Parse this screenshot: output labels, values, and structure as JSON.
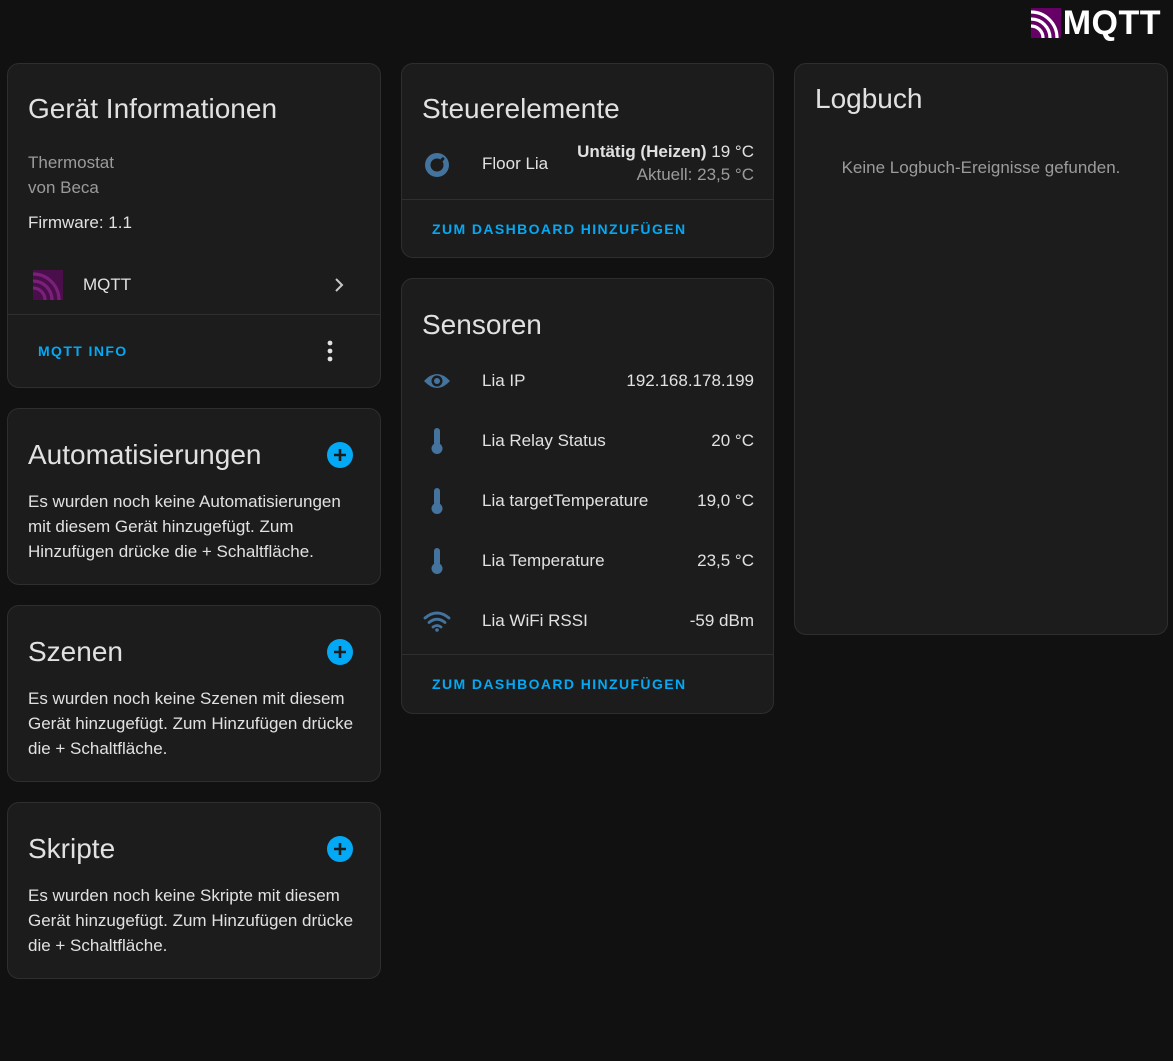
{
  "brand": {
    "text": "MQTT",
    "icon": "mqtt-logo-icon",
    "color": "#660066"
  },
  "colors": {
    "accent": "#03a9f4",
    "icon": "#44739e",
    "background": "#111111",
    "card": "#1c1c1c"
  },
  "device_info": {
    "title": "Gerät Informationen",
    "model": "Thermostat",
    "manufacturer": "von Beca",
    "firmware": "Firmware: 1.1",
    "integration": {
      "label": "MQTT",
      "icon": "mqtt-logo-icon"
    },
    "action_label": "MQTT INFO"
  },
  "automations": {
    "title": "Automatisierungen",
    "description": "Es wurden noch keine Automatisierungen mit diesem Gerät hinzugefügt. Zum Hinzufügen drücke die + Schaltfläche."
  },
  "scenes": {
    "title": "Szenen",
    "description": "Es wurden noch keine Szenen mit diesem Gerät hinzugefügt. Zum Hinzufügen drücke die + Schaltfläche."
  },
  "scripts": {
    "title": "Skripte",
    "description": "Es wurden noch keine Skripte mit diesem Gerät hinzugefügt. Zum Hinzufügen drücke die + Schaltfläche."
  },
  "controls": {
    "title": "Steuerelemente",
    "entity": {
      "name": "Floor Lia",
      "icon": "thermostat-icon",
      "state": "Untätig (Heizen)",
      "target": "19 °C",
      "current": "Aktuell: 23,5 °C"
    },
    "action_label": "ZUM DASHBOARD HINZUFÜGEN"
  },
  "sensors": {
    "title": "Sensoren",
    "items": [
      {
        "name": "Lia IP",
        "value": "192.168.178.199",
        "icon": "eye-icon"
      },
      {
        "name": "Lia Relay Status",
        "value": "20 °C",
        "icon": "thermometer-icon"
      },
      {
        "name": "Lia targetTemperature",
        "value": "19,0 °C",
        "icon": "thermometer-icon"
      },
      {
        "name": "Lia Temperature",
        "value": "23,5 °C",
        "icon": "thermometer-icon"
      },
      {
        "name": "Lia WiFi RSSI",
        "value": "-59 dBm",
        "icon": "wifi-icon"
      }
    ],
    "action_label": "ZUM DASHBOARD HINZUFÜGEN"
  },
  "logbook": {
    "title": "Logbuch",
    "empty_text": "Keine Logbuch-Ereignisse gefunden."
  }
}
